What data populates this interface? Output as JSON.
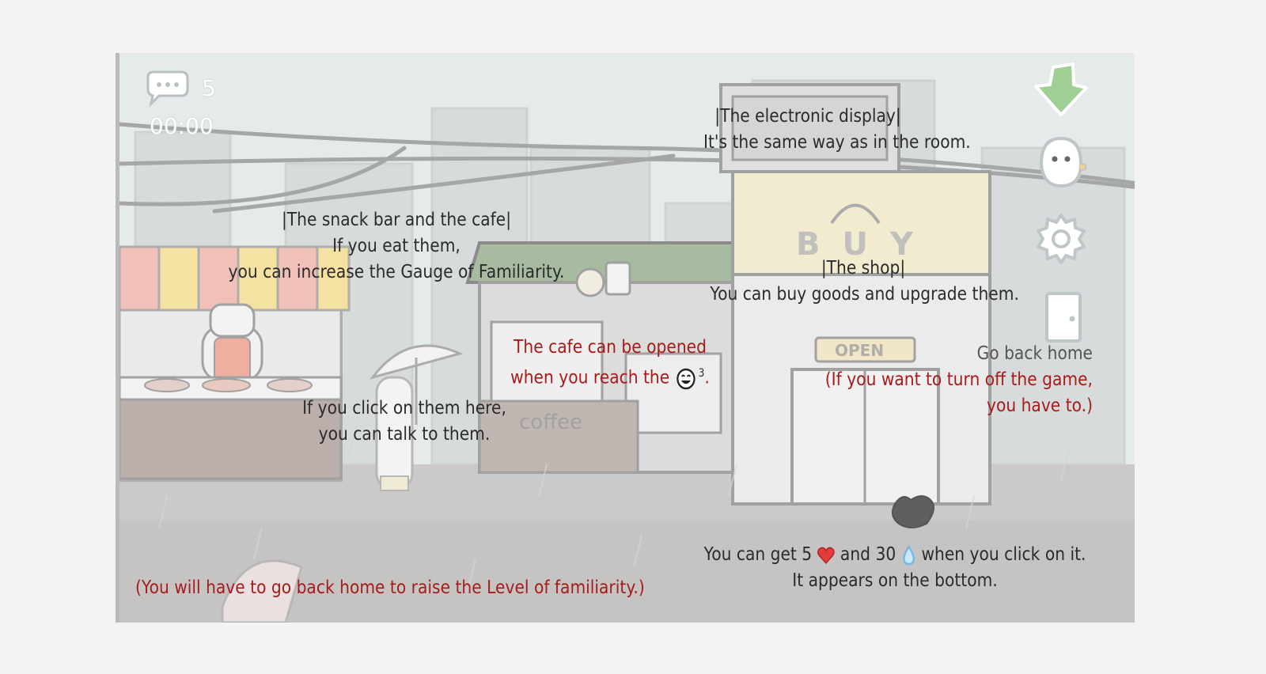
{
  "hud": {
    "message_count": "5",
    "timer": "00:00"
  },
  "tutorial": {
    "display": {
      "title": "|The electronic display|",
      "line1": "It's the same way as in the room."
    },
    "snack": {
      "title": "|The snack bar and the cafe|",
      "line1": "If you eat them,",
      "line2": "you can increase the Gauge of Familiarity."
    },
    "shop": {
      "title": "|The shop|",
      "line1": "You can buy goods and upgrade them."
    },
    "cafe": {
      "line1": "The cafe can be opened",
      "line2_prefix": "when you reach the",
      "superscript": "3",
      "line2_suffix": "."
    },
    "talk": {
      "line1": "If you click on them here,",
      "line2": "you can talk to them."
    },
    "home": {
      "title": "Go back home",
      "line1": "(If you want to turn off the game,",
      "line2": "you have to.)"
    },
    "bag": {
      "prefix": "You can get 5",
      "middle": "and 30",
      "suffix": "when you click on it.",
      "line2": "It appears on the bottom."
    },
    "level": {
      "text": "(You will have to go back home to raise the Level of familiarity.)"
    }
  },
  "scene": {
    "shop_sign": "BUY",
    "open_sign": "OPEN",
    "cafe_sign": "coffee"
  },
  "icons": {
    "message": "speech-bubble-icon",
    "arrow": "green-down-arrow-icon",
    "ghost": "ghost-profile-icon",
    "settings": "gear-icon",
    "home": "door-icon",
    "heart": "heart-icon",
    "drop": "water-drop-icon",
    "smiley": "smiley-face-icon",
    "bag": "trash-bag-icon"
  },
  "colors": {
    "tip_text": "#2b2b2b",
    "tip_red": "#a71b1b",
    "arrow_green": "#9fcf94",
    "heart": "#e23b3b",
    "drop": "#6fb7e8"
  }
}
